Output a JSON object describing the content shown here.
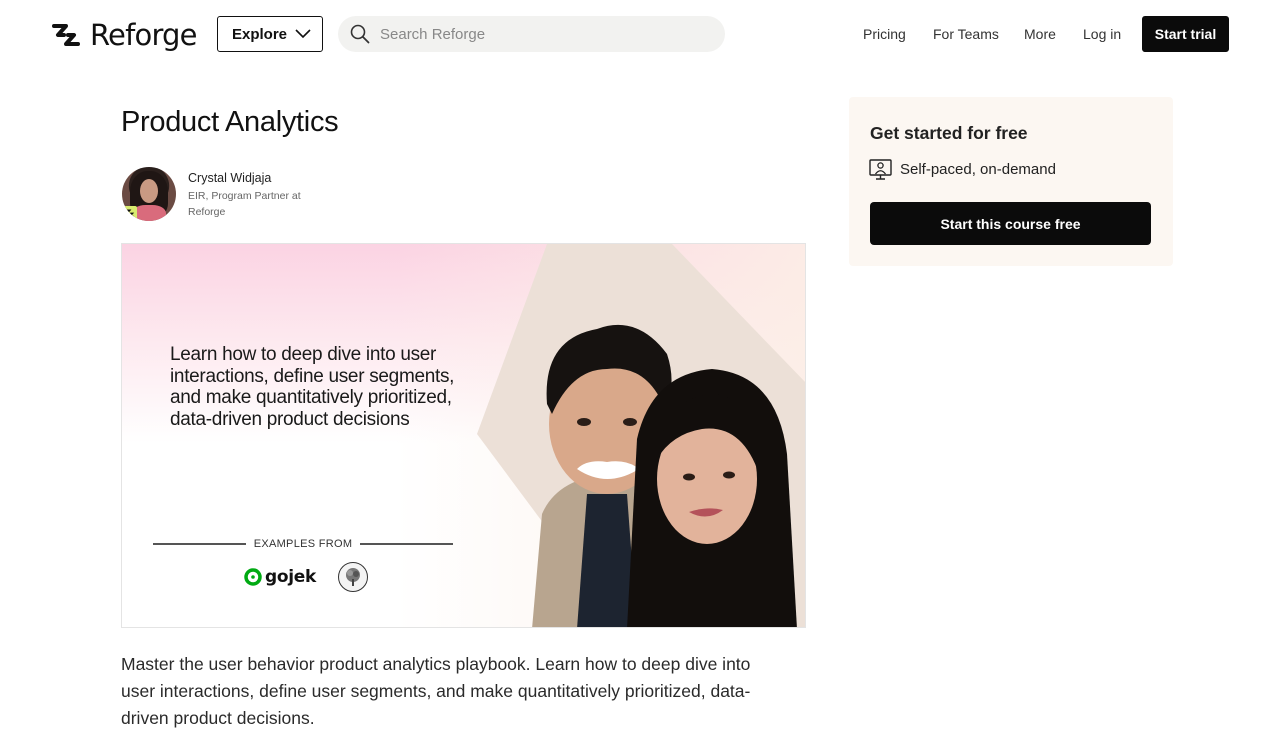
{
  "nav": {
    "logo_text": "Reforge",
    "explore_label": "Explore",
    "search_placeholder": "Search Reforge",
    "links": [
      "Pricing",
      "For Teams",
      "More",
      "Log in"
    ],
    "start_trial_label": "Start trial"
  },
  "course": {
    "title": "Product Analytics",
    "author_name": "Crystal Widjaja",
    "author_role": "EIR, Program Partner at Reforge",
    "hero": {
      "headline": "Learn how to deep dive into user interactions, define user segments, and make quantitatively prioritized, data-driven product decisions",
      "examples_label": "EXAMPLES FROM",
      "example_logo": "gojek"
    },
    "description": "Master the user behavior product analytics playbook. Learn how to deep dive into user interactions, define user segments, and make quantitatively prioritized, data-driven product decisions."
  },
  "sidebar": {
    "card_title": "Get started for free",
    "feature": "Self-paced, on-demand",
    "cta_label": "Start this course free"
  },
  "colors": {
    "primary_button": "#0b0b0b",
    "card_bg": "#fcf7f2",
    "search_bg": "#f2f2f0",
    "badge": "#d9ec6f",
    "gojek_green": "#00aa13"
  }
}
